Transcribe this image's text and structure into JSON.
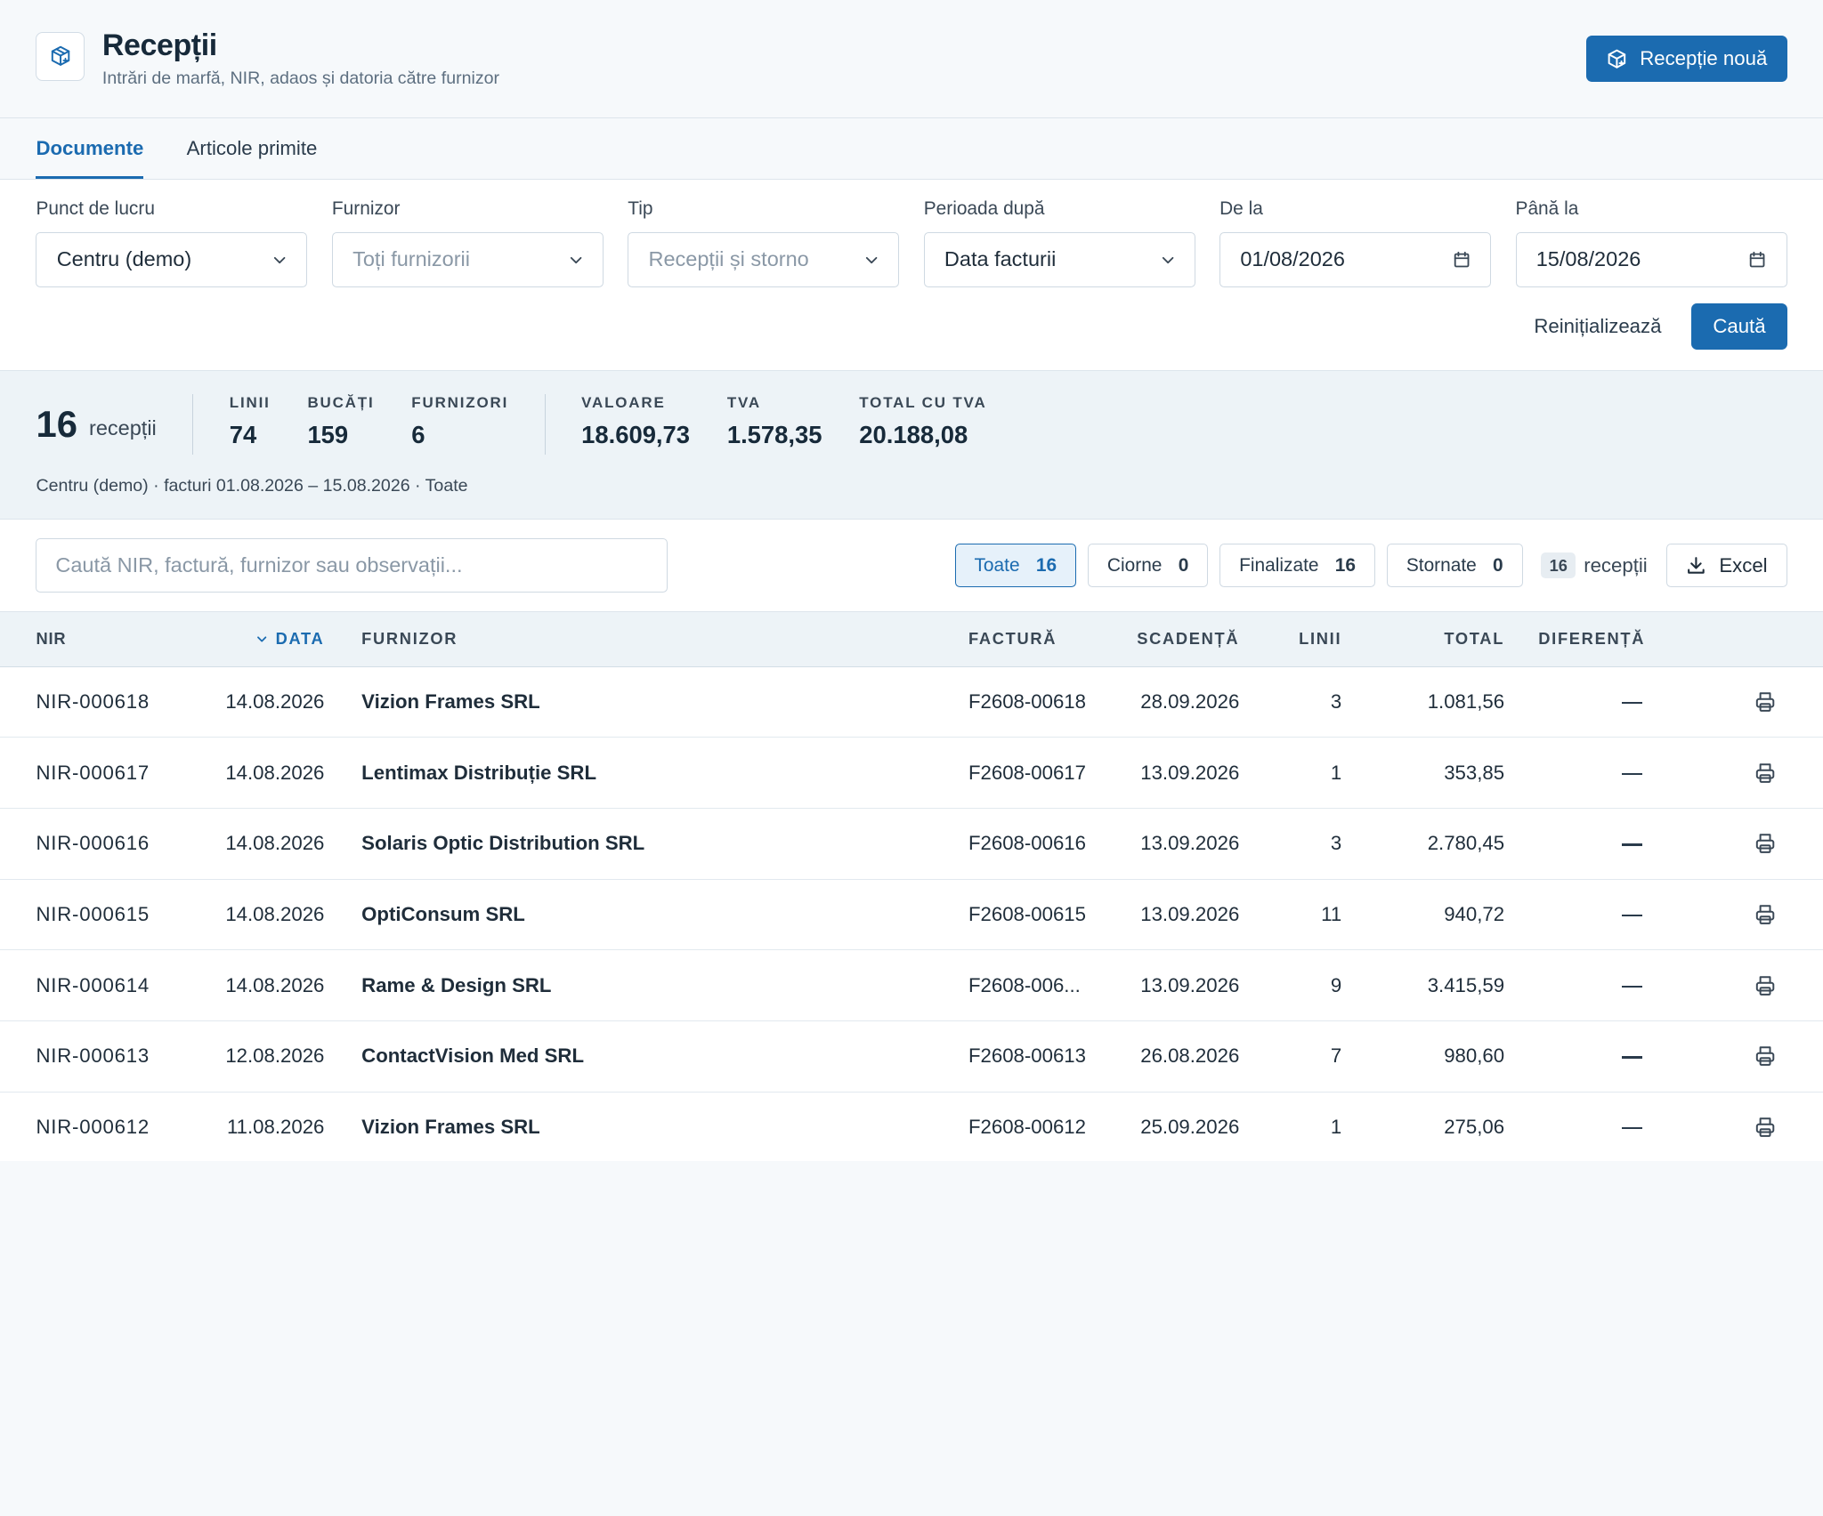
{
  "header": {
    "title": "Recepții",
    "subtitle": "Intrări de marfă, NIR, adaos și datoria către furnizor",
    "new_button": "Recepție nouă",
    "icon": "package-plus-icon"
  },
  "tabs": [
    {
      "label": "Documente",
      "active": true
    },
    {
      "label": "Articole primite",
      "active": false
    }
  ],
  "filters": {
    "punct": {
      "label": "Punct de lucru",
      "value": "Centru (demo)"
    },
    "furnizor": {
      "label": "Furnizor",
      "placeholder": "Toți furnizorii"
    },
    "tip": {
      "label": "Tip",
      "placeholder": "Recepții și storno"
    },
    "perioada": {
      "label": "Perioada după",
      "value": "Data facturii"
    },
    "de_la": {
      "label": "De la",
      "value": "01/08/2026"
    },
    "pana_la": {
      "label": "Până la",
      "value": "15/08/2026"
    },
    "reset_label": "Reinițializează",
    "search_label": "Caută"
  },
  "stats": {
    "count": "16",
    "count_unit": "recepții",
    "linii": {
      "label": "LINII",
      "value": "74"
    },
    "bucati": {
      "label": "BUCĂȚI",
      "value": "159"
    },
    "furnizori": {
      "label": "FURNIZORI",
      "value": "6"
    },
    "valoare": {
      "label": "VALOARE",
      "value": "18.609,73"
    },
    "tva": {
      "label": "TVA",
      "value": "1.578,35"
    },
    "total": {
      "label": "TOTAL CU TVA",
      "value": "20.188,08"
    },
    "caption": "Centru (demo) · facturi 01.08.2026 – 15.08.2026 · Toate"
  },
  "toolbar": {
    "search_placeholder": "Caută NIR, factură, furnizor sau observații...",
    "chips": [
      {
        "label": "Toate",
        "count": "16",
        "active": true
      },
      {
        "label": "Ciorne",
        "count": "0",
        "active": false
      },
      {
        "label": "Finalizate",
        "count": "16",
        "active": false
      },
      {
        "label": "Stornate",
        "count": "0",
        "active": false
      }
    ],
    "result_count": "16",
    "result_unit": "recepții",
    "excel_label": "Excel"
  },
  "table": {
    "columns": {
      "nir": "NIR",
      "data": "DATA",
      "furnizor": "FURNIZOR",
      "factura": "FACTURĂ",
      "scadenta": "SCADENȚĂ",
      "linii": "LINII",
      "total": "TOTAL",
      "diferenta": "DIFERENȚĂ"
    },
    "rows": [
      {
        "nir": "NIR-000618",
        "data": "14.08.2026",
        "furnizor": "Vizion Frames SRL",
        "factura": "F2608-00618",
        "scadenta": "28.09.2026",
        "linii": "3",
        "total": "1.081,56"
      },
      {
        "nir": "NIR-000617",
        "data": "14.08.2026",
        "furnizor": "Lentimax Distribuție SRL",
        "factura": "F2608-00617",
        "scadenta": "13.09.2026",
        "linii": "1",
        "total": "353,85"
      },
      {
        "nir": "NIR-000616",
        "data": "14.08.2026",
        "furnizor": "Solaris Optic Distribution SRL",
        "factura": "F2608-00616",
        "scadenta": "13.09.2026",
        "linii": "3",
        "total": "2.780,45"
      },
      {
        "nir": "NIR-000615",
        "data": "14.08.2026",
        "furnizor": "OptiConsum SRL",
        "factura": "F2608-00615",
        "scadenta": "13.09.2026",
        "linii": "11",
        "total": "940,72"
      },
      {
        "nir": "NIR-000614",
        "data": "14.08.2026",
        "furnizor": "Rame & Design SRL",
        "factura": "F2608-006...",
        "scadenta": "13.09.2026",
        "linii": "9",
        "total": "3.415,59"
      },
      {
        "nir": "NIR-000613",
        "data": "12.08.2026",
        "furnizor": "ContactVision Med SRL",
        "factura": "F2608-00613",
        "scadenta": "26.08.2026",
        "linii": "7",
        "total": "980,60"
      },
      {
        "nir": "NIR-000612",
        "data": "11.08.2026",
        "furnizor": "Vizion Frames SRL",
        "factura": "F2608-00612",
        "scadenta": "25.09.2026",
        "linii": "1",
        "total": "275,06"
      }
    ]
  },
  "colors": {
    "accent": "#1b6bb0",
    "text": "#1f2d3a",
    "muted": "#5d6f80",
    "band": "#edf3f7"
  }
}
